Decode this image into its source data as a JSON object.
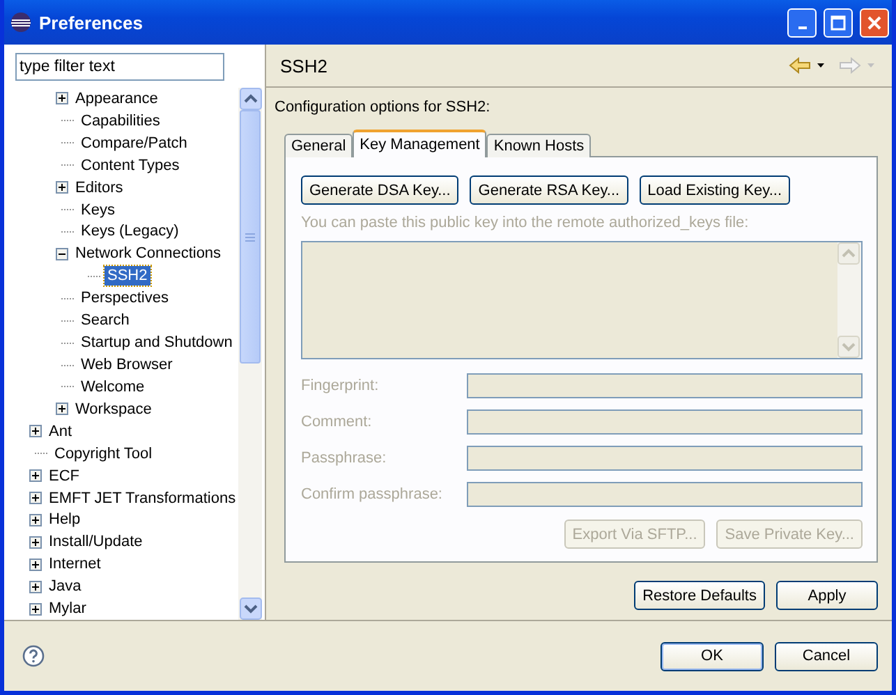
{
  "window": {
    "title": "Preferences"
  },
  "filter": {
    "value": "type filter text"
  },
  "tree": {
    "items": [
      {
        "children": [
          {
            "kind": "folder",
            "label": "Appearance",
            "expanded": false,
            "selected": false
          },
          {
            "kind": "leaf",
            "label": "Capabilities",
            "selected": false
          },
          {
            "kind": "leaf",
            "label": "Compare/Patch",
            "selected": false
          },
          {
            "kind": "leaf",
            "label": "Content Types",
            "selected": false
          },
          {
            "kind": "folder",
            "label": "Editors",
            "expanded": false,
            "selected": false
          },
          {
            "kind": "leaf",
            "label": "Keys",
            "selected": false
          },
          {
            "kind": "leaf",
            "label": "Keys (Legacy)",
            "selected": false
          },
          {
            "kind": "folder",
            "label": "Network Connections",
            "expanded": true,
            "selected": false,
            "children": [
              {
                "kind": "leaf",
                "label": "SSH2",
                "selected": true
              }
            ]
          },
          {
            "kind": "leaf",
            "label": "Perspectives",
            "selected": false
          },
          {
            "kind": "leaf",
            "label": "Search",
            "selected": false
          },
          {
            "kind": "leaf",
            "label": "Startup and Shutdown",
            "selected": false
          },
          {
            "kind": "leaf",
            "label": "Web Browser",
            "selected": false
          },
          {
            "kind": "leaf",
            "label": "Welcome",
            "selected": false
          },
          {
            "kind": "folder",
            "label": "Workspace",
            "expanded": false,
            "selected": false
          }
        ]
      },
      {
        "kind": "folder",
        "label": "Ant",
        "expanded": false,
        "selected": false
      },
      {
        "kind": "leaf",
        "label": "Copyright Tool",
        "selected": false
      },
      {
        "kind": "folder",
        "label": "ECF",
        "expanded": false,
        "selected": false
      },
      {
        "kind": "folder",
        "label": "EMFT JET Transformations",
        "expanded": false,
        "selected": false
      },
      {
        "kind": "folder",
        "label": "Help",
        "expanded": false,
        "selected": false
      },
      {
        "kind": "folder",
        "label": "Install/Update",
        "expanded": false,
        "selected": false
      },
      {
        "kind": "folder",
        "label": "Internet",
        "expanded": false,
        "selected": false
      },
      {
        "kind": "folder",
        "label": "Java",
        "expanded": false,
        "selected": false
      },
      {
        "kind": "folder",
        "label": "Mylar",
        "expanded": false,
        "selected": false
      }
    ]
  },
  "page": {
    "title": "SSH2",
    "description": "Configuration options for SSH2:",
    "tabs": [
      {
        "label": "General",
        "selected": false
      },
      {
        "label": "Key Management",
        "selected": true
      },
      {
        "label": "Known Hosts",
        "selected": false
      }
    ],
    "key_buttons": [
      {
        "label": "Generate DSA Key...",
        "disabled": false
      },
      {
        "label": "Generate RSA Key...",
        "disabled": false
      },
      {
        "label": "Load Existing Key...",
        "disabled": false
      }
    ],
    "public_key_label": "You can paste this public key into the remote authorized_keys file:",
    "fields": [
      {
        "label": "Fingerprint:",
        "disabled": true
      },
      {
        "label": "Comment:",
        "disabled": true
      },
      {
        "label": "Passphrase:",
        "disabled": true
      },
      {
        "label": "Confirm passphrase:",
        "disabled": true
      }
    ],
    "key_actions": [
      {
        "label": "Export Via SFTP...",
        "disabled": true
      },
      {
        "label": "Save Private Key...",
        "disabled": true
      }
    ],
    "page_buttons": [
      {
        "label": "Restore Defaults",
        "disabled": false
      },
      {
        "label": "Apply",
        "disabled": false
      }
    ]
  },
  "dialog_buttons": [
    {
      "label": "OK",
      "default": true
    },
    {
      "label": "Cancel",
      "default": false
    }
  ]
}
